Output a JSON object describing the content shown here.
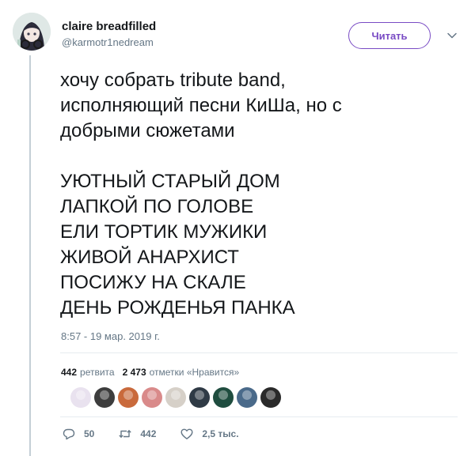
{
  "user": {
    "display_name": "claire breadfilled",
    "handle": "@karmotr1nedream"
  },
  "follow_label": "Читать",
  "tweet": {
    "text": "хочу собрать tribute band,\nисполняющий песни КиШа, но с\nдобрыми сюжетами\n\nУЮТНЫЙ СТАРЫЙ ДОМ\nЛАПКОЙ ПО ГОЛОВЕ\nЕЛИ ТОРТИК МУЖИКИ\nЖИВОЙ АНАРХИСТ\nПОСИЖУ НА СКАЛЕ\nДЕНЬ РОЖДЕНЬЯ ПАНКА",
    "timestamp": "8:57 - 19 мар. 2019 г."
  },
  "stats": {
    "retweets_count": "442",
    "retweets_label": "ретвита",
    "likes_count": "2 473",
    "likes_label": "отметки «Нравится»"
  },
  "likers": [
    {
      "color": "#e9e2ef"
    },
    {
      "color": "#3d3d3d"
    },
    {
      "color": "#c96a3c"
    },
    {
      "color": "#d98a8a"
    },
    {
      "color": "#d6d0c8"
    },
    {
      "color": "#2f3a45"
    },
    {
      "color": "#1f4d3f"
    },
    {
      "color": "#4a6a8a"
    },
    {
      "color": "#2a2a2a"
    }
  ],
  "actions": {
    "reply_count": "50",
    "retweet_count": "442",
    "like_count": "2,5 тыс."
  },
  "colors": {
    "accent": "#794bc4",
    "secondary_text": "#657786",
    "thread_line": "#c4cfd6"
  },
  "icons": {
    "reply": "reply-icon",
    "retweet": "retweet-icon",
    "like": "heart-icon",
    "caret": "chevron-down-icon"
  }
}
